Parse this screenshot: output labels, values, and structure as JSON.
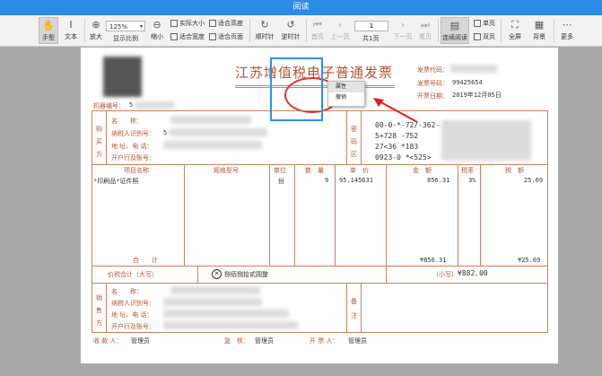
{
  "window": {
    "title": "阅读"
  },
  "toolbar": {
    "hand": "手型",
    "text": "文本",
    "zoom_in": "放大",
    "zoom_value": "125%",
    "display_ratio": "显示比例",
    "zoom_out": "缩小",
    "actual_size": "实际大小",
    "fit_height": "适合高度",
    "fit_width": "适合宽度",
    "fit_page": "适合页面",
    "rotate_cw": "顺时针",
    "rotate_ccw": "逆时针",
    "first_page": "首页",
    "prev_page": "上一页",
    "page_current": "1",
    "page_total": "共1页",
    "next_page": "下一页",
    "last_page": "尾页",
    "continuous": "连续阅读",
    "single": "单页",
    "double": "双页",
    "fullscreen": "全屏",
    "background": "背景",
    "more": "更多"
  },
  "invoice": {
    "title": "江苏增值税电子普通发票",
    "code_label": "发票代码：",
    "number_label": "发票号码：",
    "number_value": "99425654",
    "date_label": "开票日期：",
    "date_value": "2019年12月05日",
    "machine_label": "机器编号：",
    "machine_value": "5",
    "buyer": "购买方",
    "buyer_name": "名　　称：",
    "buyer_taxid": "纳税人识别号：",
    "buyer_taxid_value": "5",
    "buyer_addr": "地 址、电 话：",
    "buyer_bank": "开户行及账号：",
    "cipher_area": "密码区",
    "cipher_1": "00-0-*-72/-362-  04",
    "cipher_2": "5+728  -752",
    "cipher_3": "27<36  *183",
    "cipher_4": "0923-0  *<525>",
    "col_item": "项目名称",
    "col_spec": "规格型号",
    "col_unit": "单位",
    "col_qty": "数　量",
    "col_price": "单　价",
    "col_amount": "金　额",
    "col_rate": "税率",
    "col_tax": "税　额",
    "item_name": "*印刷品*证件照",
    "item_unit": "份",
    "item_qty": "9",
    "item_price": "95.145631",
    "item_amount": "856.31",
    "item_rate": "3%",
    "item_tax": "25.69",
    "total_label": "合　　计",
    "total_amount": "¥856.31",
    "total_tax": "¥25.69",
    "sum_label": "价税合计（大写）",
    "sum_words": "捌佰捌拾贰圆整",
    "sum_small_label": "（小写）",
    "sum_small_value": "¥882.00",
    "seller": "销售方",
    "seller_name": "名　　称：",
    "seller_taxid": "纳税人识别号：",
    "seller_addr": "地 址、电 话：",
    "seller_bank": "开户行及账号：",
    "remark": "备注",
    "payee_label": "收 款 人：",
    "payee_value": "管理员",
    "reviewer_label": "复　核：",
    "reviewer_value": "管理员",
    "issuer_label": "开 票 人：",
    "issuer_value": "管理员"
  },
  "context_menu": {
    "item_1": "属性",
    "item_2": "撤销"
  }
}
